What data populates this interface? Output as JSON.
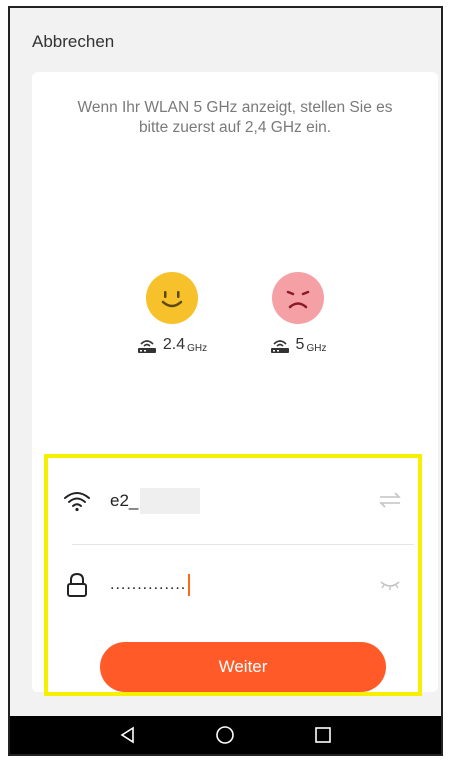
{
  "header": {
    "cancel_label": "Abbrechen"
  },
  "hint": {
    "text": "Wenn Ihr WLAN 5 GHz anzeigt, stellen Sie es bitte zuerst auf 2,4 GHz ein."
  },
  "frequencies": [
    {
      "value": "2.4",
      "unit": "GHz",
      "mood": "happy",
      "color": "#f6c12a",
      "icon": "router-icon"
    },
    {
      "value": "5",
      "unit": "GHz",
      "mood": "sad",
      "color": "#f5a0a4",
      "icon": "router-icon"
    }
  ],
  "wifi": {
    "ssid": "e2_",
    "icon": "wifi-icon",
    "switch_icon": "switch-arrows-icon"
  },
  "password": {
    "masked": "..............",
    "icon": "lock-icon",
    "visibility_icon": "eye-closed-icon"
  },
  "actions": {
    "next_label": "Weiter"
  },
  "colors": {
    "accent": "#ff5a28",
    "highlight": "#f6f000"
  },
  "navbar": {
    "back_icon": "back-triangle-icon",
    "home_icon": "home-circle-icon",
    "recents_icon": "recents-square-icon"
  }
}
